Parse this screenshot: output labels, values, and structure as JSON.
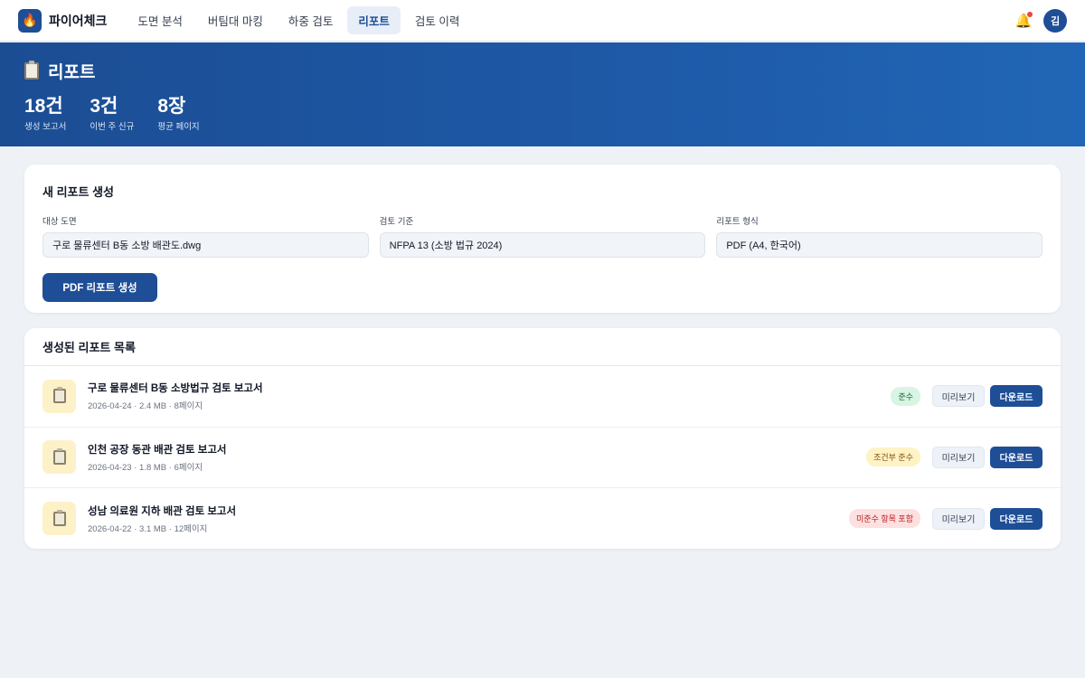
{
  "app": {
    "name": "파이어체크",
    "logo_icon": "flame-icon"
  },
  "nav": {
    "tabs": [
      {
        "label": "도면 분석",
        "active": false
      },
      {
        "label": "버팀대 마킹",
        "active": false
      },
      {
        "label": "하중 검토",
        "active": false
      },
      {
        "label": "리포트",
        "active": true
      },
      {
        "label": "검토 이력",
        "active": false
      }
    ],
    "avatar_initial": "김",
    "has_notification": true
  },
  "hero": {
    "title": "리포트",
    "stats": [
      {
        "value": "18건",
        "label": "생성 보고서"
      },
      {
        "value": "3건",
        "label": "이번 주 신규"
      },
      {
        "value": "8장",
        "label": "평균 페이지"
      }
    ]
  },
  "new_report": {
    "title": "새 리포트 생성",
    "fields": [
      {
        "label": "대상 도면",
        "value": "구로 물류센터 B동 소방 배관도.dwg"
      },
      {
        "label": "검토 기준",
        "value": "NFPA 13 (소방 법규 2024)"
      },
      {
        "label": "리포트 형식",
        "value": "PDF (A4, 한국어)"
      }
    ],
    "button_label": "PDF 리포트 생성"
  },
  "report_list": {
    "title": "생성된 리포트 목록",
    "preview_label": "미리보기",
    "download_label": "다운로드",
    "items": [
      {
        "title": "구로 물류센터 B동 소방법규 검토 보고서",
        "meta": "2026-04-24 · 2.4 MB · 8페이지",
        "status": "준수",
        "status_type": "ok"
      },
      {
        "title": "인천 공장 동관 배관 검토 보고서",
        "meta": "2026-04-23 · 1.8 MB · 6페이지",
        "status": "조건부 준수",
        "status_type": "cond"
      },
      {
        "title": "성남 의료원 지하 배관 검토 보고서",
        "meta": "2026-04-22 · 3.1 MB · 12페이지",
        "status": "미준수 항목 포함",
        "status_type": "bad"
      }
    ]
  },
  "colors": {
    "primary": "#1e4e96",
    "hero_start": "#1b4d93",
    "hero_end": "#2166b6",
    "background": "#eef1f6"
  }
}
